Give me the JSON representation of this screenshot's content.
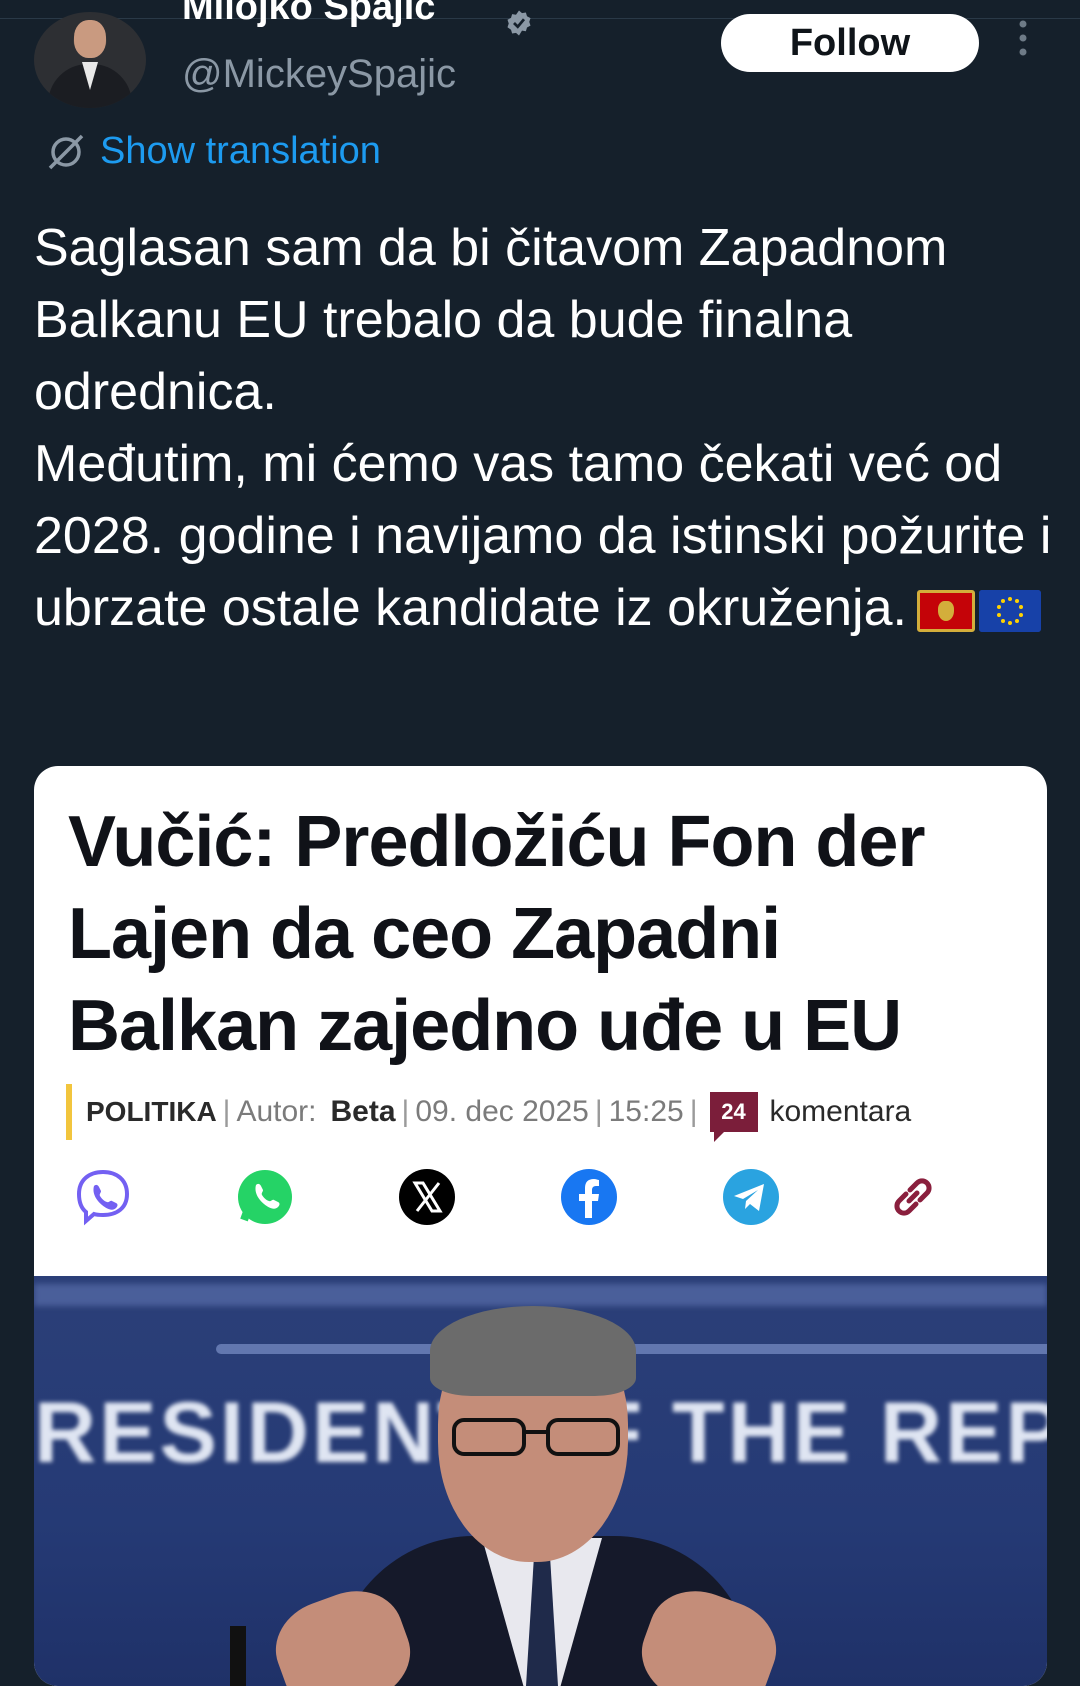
{
  "tweet": {
    "author_name": "Milojko Spajić",
    "handle": "@MickeySpajic",
    "follow_label": "Follow",
    "show_translation_label": "Show translation",
    "text_lines": [
      "Saglasan sam da bi čitavom Zapadnom Balkanu EU trebalo da bude finalna odrednica.",
      "Međutim, mi ćemo vas tamo čekati već od 2028. godine i navijamo da istinski požurite i ubrzate ostale kandidate iz okruženja."
    ],
    "emoji": [
      "montenegro-flag",
      "eu-flag"
    ]
  },
  "article": {
    "headline": "Vučić: Predložiću Fon der Lajen da ceo Zapadni Balkan zajedno uđe u EU",
    "category": "POLITIKA",
    "author_label": "Autor:",
    "author": "Beta",
    "date": "09. dec 2025",
    "time": "15:25",
    "comment_count": "24",
    "comments_label": "komentara",
    "share_icons": [
      "viber-icon",
      "whatsapp-icon",
      "x-icon",
      "facebook-icon",
      "telegram-icon",
      "link-icon"
    ],
    "photo_backdrop_text": "RESIDENT OF THE REPUB"
  },
  "colors": {
    "background": "#15202b",
    "link": "#1d9bf0",
    "category_bar": "#f2c53d",
    "comment_badge": "#7b1e3a"
  }
}
